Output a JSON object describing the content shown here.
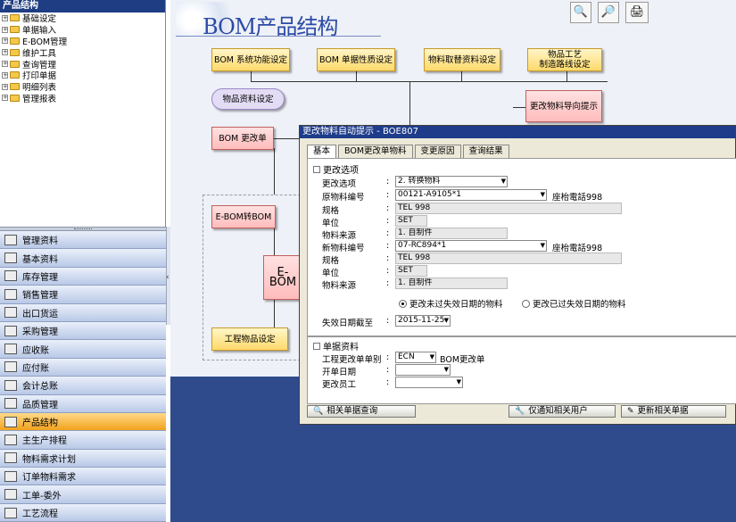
{
  "tree": {
    "header": "产品结构",
    "items": [
      "基础设定",
      "单据输入",
      "E-BOM管理",
      "维护工具",
      "查询管理",
      "打印单据",
      "明细列表",
      "管理报表"
    ]
  },
  "modules": {
    "items": [
      {
        "label": "管理资料",
        "icon": "document-icon"
      },
      {
        "label": "基本资料",
        "icon": "card-icon"
      },
      {
        "label": "库存管理",
        "icon": "inventory-icon"
      },
      {
        "label": "销售管理",
        "icon": "sales-icon"
      },
      {
        "label": "出口货运",
        "icon": "shipping-icon"
      },
      {
        "label": "采购管理",
        "icon": "purchase-icon"
      },
      {
        "label": "应收账",
        "icon": "receivable-icon"
      },
      {
        "label": "应付账",
        "icon": "payable-icon"
      },
      {
        "label": "会计总账",
        "icon": "ledger-icon"
      },
      {
        "label": "品质管理",
        "icon": "quality-icon"
      },
      {
        "label": "产品结构",
        "icon": "structure-icon"
      },
      {
        "label": "主生产排程",
        "icon": "schedule-icon"
      },
      {
        "label": "物料需求计划",
        "icon": "mrp-icon"
      },
      {
        "label": "订单物料需求",
        "icon": "order-icon"
      },
      {
        "label": "工单-委外",
        "icon": "workorder-icon"
      },
      {
        "label": "工艺流程",
        "icon": "process-icon"
      }
    ],
    "active_index": 10
  },
  "main": {
    "title": "BOM产品结构",
    "tools": [
      {
        "name": "zoom-in-icon",
        "glyph": "🔍"
      },
      {
        "name": "zoom-out-icon",
        "glyph": "🔎"
      },
      {
        "name": "printer-icon",
        "glyph": "🖨"
      }
    ],
    "flow": {
      "bom_function": "BOM 系统功能设定",
      "bom_attr": "BOM 单据性质设定",
      "substitute": "物料取替资料设定",
      "routing_line1": "物品工艺",
      "routing_line2": "制造路线设定",
      "item_setup": "物品资料设定",
      "change_guide": "更改物料导向提示",
      "bom_change": "BOM 更改单",
      "ebom_to_bom": "E-BOM转BOM",
      "ebom": "E-BOM",
      "eng_item": "工程物品设定"
    }
  },
  "dialog": {
    "title": "更改物料自动提示 - BOE807",
    "tabs": [
      "基本",
      "BOM更改单物料",
      "变更原因",
      "查询结果"
    ],
    "change_section": "更改选项",
    "fields": {
      "change_option_label": "更改选项",
      "change_option_value": "2. 转换物料",
      "orig_item_label": "原物料编号",
      "orig_item_value": "00121-A9105*1",
      "orig_item_desc": "座枱電話998",
      "orig_spec_label": "规格",
      "orig_spec_value": "TEL 998",
      "orig_unit_label": "单位",
      "orig_unit_value": "SET",
      "orig_source_label": "物料来源",
      "orig_source_value": "1. 自制件",
      "new_item_label": "新物料编号",
      "new_item_value": "07-RC894*1",
      "new_item_desc": "座枱電話998",
      "new_spec_label": "规格",
      "new_spec_value": "TEL 998",
      "new_unit_label": "单位",
      "new_unit_value": "SET",
      "new_source_label": "物料来源",
      "new_source_value": "1. 自制件",
      "radio_unexpired": "更改未过失效日期的物料",
      "radio_expired": "更改已过失效日期的物料",
      "expiry_label": "失效日期截至",
      "expiry_value": "2015-11-25"
    },
    "doc_section": "单据资料",
    "doc": {
      "type_label": "工程更改单单别",
      "type_value": "ECN",
      "type_desc": "BOM更改单",
      "date_label": "开单日期",
      "date_value": "",
      "staff_label": "更改员工",
      "staff_value": ""
    },
    "buttons": {
      "query": "相关单据查询",
      "notify": "仅通知相关用户",
      "update": "更新相关单据"
    }
  }
}
